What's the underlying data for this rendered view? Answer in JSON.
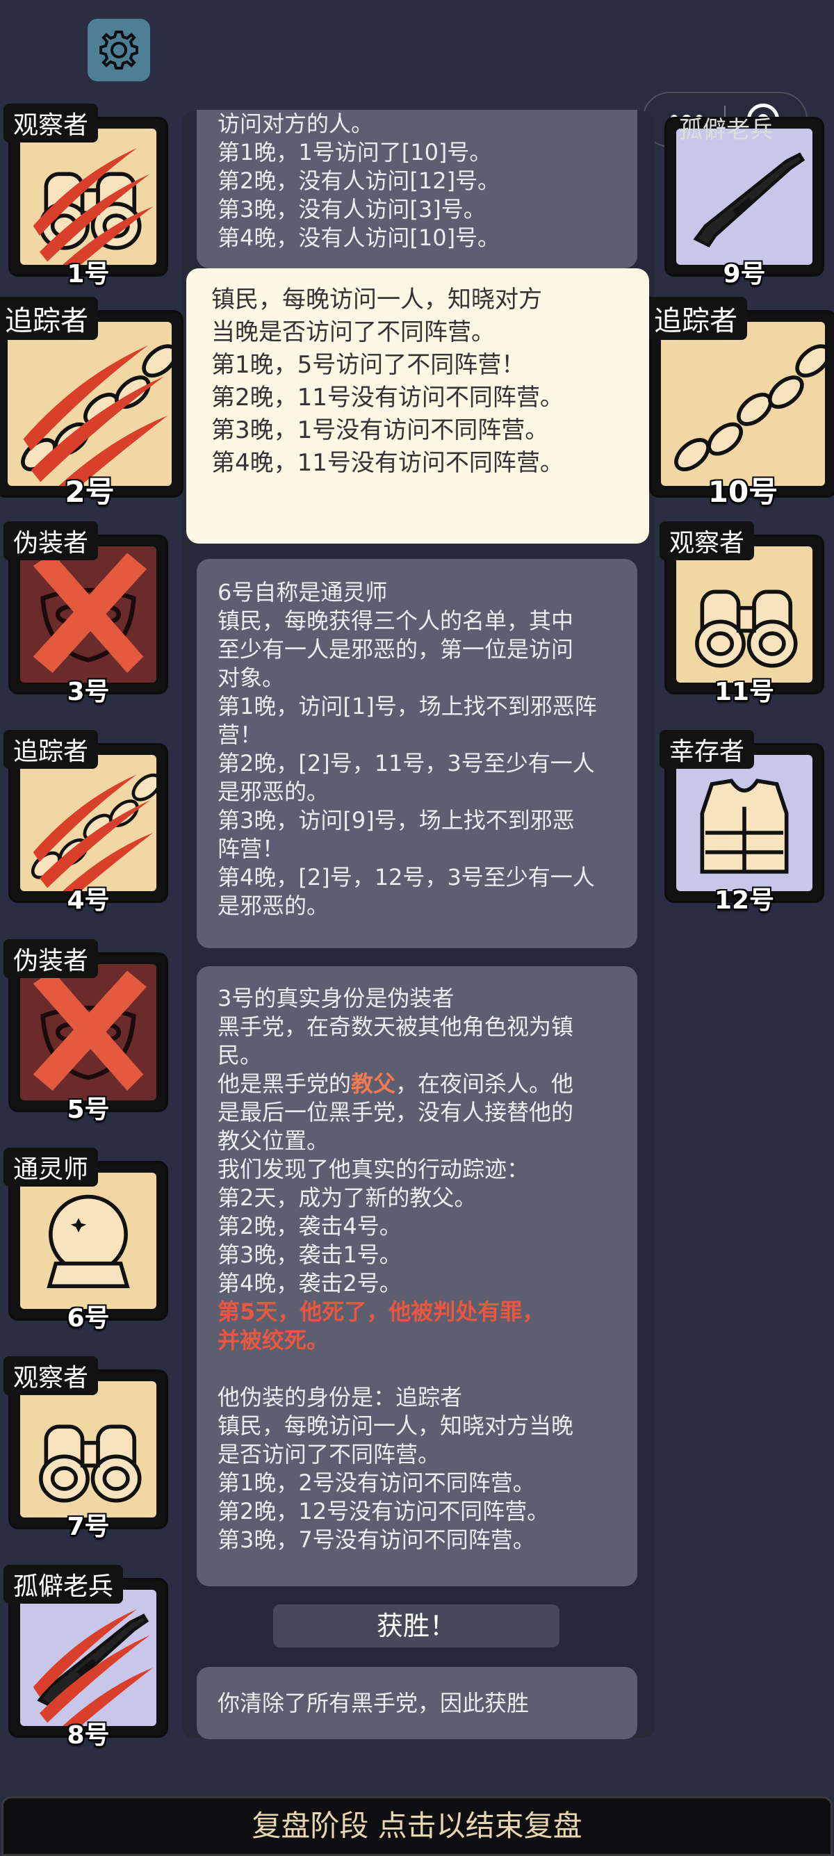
{
  "settings_icon": "gear-icon",
  "capsule": {
    "more_icon": "more-dots-icon",
    "close_icon": "target-close-icon"
  },
  "colors": {
    "background": "#2b2d42",
    "card_tan": "#f1d7a4",
    "card_lavender": "#c8c7ea",
    "card_dead": "#6b2b2b",
    "claw": "#d9402b",
    "highlight": "#e8573f"
  },
  "players_left": [
    {
      "role": "观察者",
      "num": "1号",
      "icon": "binoculars-icon",
      "state": "claw"
    },
    {
      "role": "追踪者",
      "num": "2号",
      "icon": "footprints-icon",
      "state": "claw"
    },
    {
      "role": "伪装者",
      "num": "3号",
      "icon": "mask-icon",
      "state": "dead"
    },
    {
      "role": "追踪者",
      "num": "4号",
      "icon": "footprints-icon",
      "state": "claw"
    },
    {
      "role": "伪装者",
      "num": "5号",
      "icon": "mask-icon",
      "state": "dead"
    },
    {
      "role": "通灵师",
      "num": "6号",
      "icon": "crystal-ball-icon",
      "state": "alive"
    },
    {
      "role": "观察者",
      "num": "7号",
      "icon": "binoculars-icon",
      "state": "alive"
    },
    {
      "role": "孤僻老兵",
      "num": "8号",
      "icon": "rifle-icon",
      "state": "claw"
    }
  ],
  "players_right": [
    {
      "role": "孤僻老兵",
      "num": "9号",
      "icon": "rifle-icon",
      "state": "alive"
    },
    {
      "role": "追踪者",
      "num": "10号",
      "icon": "footprints-icon",
      "state": "alive"
    },
    {
      "role": "观察者",
      "num": "11号",
      "icon": "binoculars-icon",
      "state": "alive"
    },
    {
      "role": "幸存者",
      "num": "12号",
      "icon": "vest-icon",
      "state": "alive"
    }
  ],
  "messages": {
    "m1": {
      "lines": [
        "访问对方的人。",
        "第1晚，1号访问了[10]号。",
        "第2晚，没有人访问[12]号。",
        "第3晚，没有人访问[3]号。",
        "第4晚，没有人访问[10]号。"
      ]
    },
    "m2": {
      "lines": [
        "镇民，每晚访问一人，知晓对方",
        "当晚是否访问了不同阵营。",
        "第1晚，5号访问了不同阵营！",
        "第2晚，11号没有访问不同阵营。",
        "第3晚，1号没有访问不同阵营。",
        "第4晚，11号没有访问不同阵营。"
      ]
    },
    "m3": {
      "lines": [
        "6号自称是通灵师",
        "镇民，每晚获得三个人的名单，其中",
        "至少有一人是邪恶的，第一位是访问",
        "对象。",
        "第1晚，访问[1]号，场上找不到邪恶阵",
        "营！",
        "第2晚，[2]号，11号，3号至少有一人",
        "是邪恶的。",
        "第3晚，访问[9]号，场上找不到邪恶",
        "阵营！",
        "第4晚，[2]号，12号，3号至少有一人",
        "是邪恶的。"
      ]
    },
    "m4": {
      "l1": "3号的真实身份是伪装者",
      "l2": "黑手党，在奇数天被其他角色视为镇",
      "l3": "民。",
      "l4a": "他是黑手党的",
      "l4b": "教父",
      "l4c": "，在夜间杀人。他",
      "l5": "是最后一位黑手党，没有人接替他的",
      "l6": "教父位置。",
      "l7": "我们发现了他真实的行动踪迹：",
      "l8": "第2天，成为了新的教父。",
      "l9": "第2晚，袭击4号。",
      "l10": "第3晚，袭击1号。",
      "l11": "第4晚，袭击2号。",
      "l12": "第5天，他死了，他被判处有罪，",
      "l13": "并被绞死。",
      "l14": "他伪装的身份是：追踪者",
      "l15": "镇民，每晚访问一人，知晓对方当晚",
      "l16": "是否访问了不同阵营。",
      "l17": "第1晚，2号没有访问不同阵营。",
      "l18": "第2晚，12号没有访问不同阵营。",
      "l19": "第3晚，7号没有访问不同阵营。"
    },
    "victory": "获胜！",
    "m5": "你清除了所有黑手党，因此获胜"
  },
  "bottom_bar": "复盘阶段 点击以结束复盘"
}
